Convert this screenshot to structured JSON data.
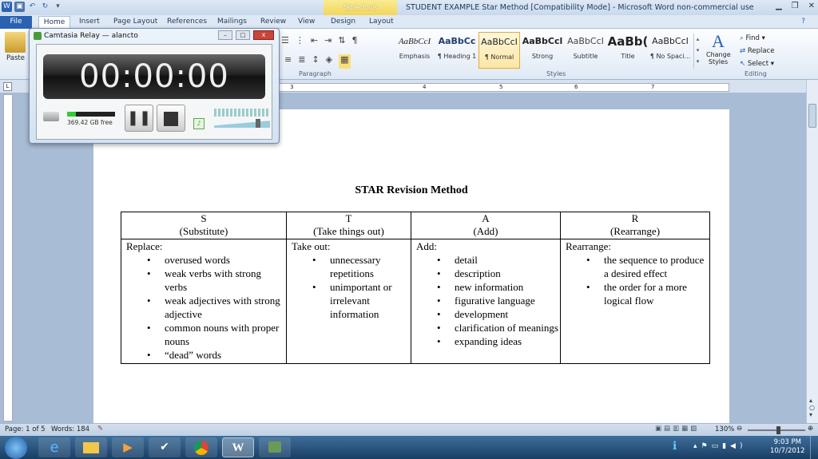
{
  "window": {
    "title": "STUDENT EXAMPLE Star Method [Compatibility Mode]  -  Microsoft Word non-commercial use",
    "contextual_tab_group": "Table Tools"
  },
  "tabs": [
    "File",
    "Home",
    "Insert",
    "Page Layout",
    "References",
    "Mailings",
    "Review",
    "View",
    "Design",
    "Layout"
  ],
  "ribbon": {
    "paste_label": "Paste",
    "paragraph_group": "Paragraph",
    "styles_group": "Styles",
    "editing_group": "Editing",
    "styles": [
      {
        "preview": "AaBbCcI",
        "name": "Emphasis"
      },
      {
        "preview": "AaBbCc",
        "name": "¶ Heading 1"
      },
      {
        "preview": "AaBbCcI",
        "name": "¶ Normal"
      },
      {
        "preview": "AaBbCcl",
        "name": "Strong"
      },
      {
        "preview": "AaBbCcI",
        "name": "Subtitle"
      },
      {
        "preview": "AaBb(",
        "name": "Title"
      },
      {
        "preview": "AaBbCcI",
        "name": "¶ No Spaci..."
      }
    ],
    "change_styles": "Change Styles",
    "find": "Find",
    "replace": "Replace",
    "select": "Select"
  },
  "ruler_numbers": [
    "1",
    "2",
    "3",
    "4",
    "5",
    "6",
    "7"
  ],
  "document": {
    "title": "STAR Revision Method",
    "columns": [
      {
        "letter": "S",
        "sub": "(Substitute)",
        "intro": "Replace:",
        "items": [
          "overused words",
          "weak verbs with strong verbs",
          "weak adjectives with strong adjective",
          "common nouns with proper nouns",
          "“dead” words"
        ]
      },
      {
        "letter": "T",
        "sub": "(Take things out)",
        "intro": "Take out:",
        "items": [
          "unnecessary repetitions",
          "unimportant or irrelevant information"
        ]
      },
      {
        "letter": "A",
        "sub": "(Add)",
        "intro": "Add:",
        "items": [
          "detail",
          "description",
          "new information",
          "figurative language",
          "development",
          "clarification of meanings",
          "expanding ideas"
        ]
      },
      {
        "letter": "R",
        "sub": "(Rearrange)",
        "intro": "Rearrange:",
        "items": [
          "the sequence to produce a desired effect",
          "the order for a more logical flow"
        ]
      }
    ]
  },
  "camtasia": {
    "title": "Camtasia Relay — alancto",
    "timer": "00:00:00",
    "disk_free": "369.42 GB free"
  },
  "status": {
    "page": "Page: 1 of 5",
    "words": "Words: 184",
    "zoom": "130%"
  },
  "clock": {
    "time": "9:03 PM",
    "date": "10/7/2012"
  },
  "colors": {
    "file_tab": "#2a61b0",
    "table_tools": "#f2d55a",
    "normal_style_highlight": "#fde6a5"
  }
}
